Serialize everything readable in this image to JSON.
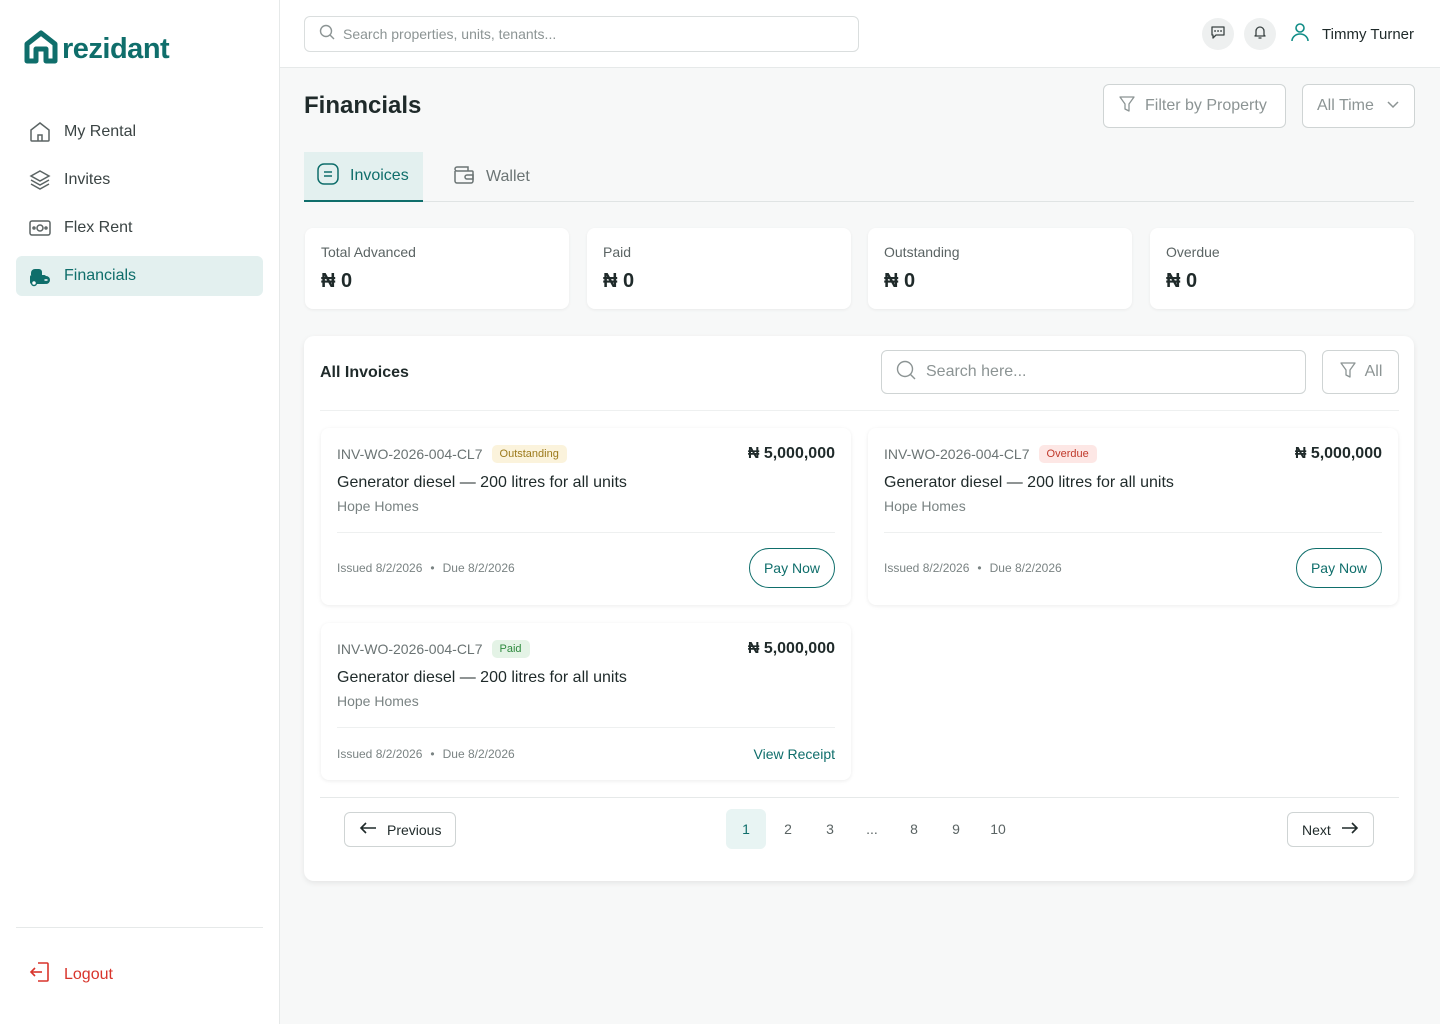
{
  "brand": {
    "name": "rezidant",
    "color": "#0f6e6b"
  },
  "sidebar": {
    "items": [
      {
        "label": "My Rental",
        "icon": "home-icon"
      },
      {
        "label": "Invites",
        "icon": "layers-icon"
      },
      {
        "label": "Flex Rent",
        "icon": "money-icon"
      },
      {
        "label": "Financials",
        "icon": "financials-icon",
        "active": true
      }
    ],
    "logout": "Logout"
  },
  "topbar": {
    "search_placeholder": "Search properties, units, tenants...",
    "user_name": "Timmy Turner"
  },
  "page": {
    "title": "Financials",
    "filter_property": "Filter by Property",
    "time_range": "All Time"
  },
  "tabs": [
    {
      "label": "Invoices",
      "active": true
    },
    {
      "label": "Wallet"
    }
  ],
  "stats": [
    {
      "label": "Total Advanced",
      "value": "₦ 0"
    },
    {
      "label": "Paid",
      "value": "₦ 0"
    },
    {
      "label": "Outstanding",
      "value": "₦ 0"
    },
    {
      "label": "Overdue",
      "value": "₦ 0"
    }
  ],
  "invoices_panel": {
    "title": "All Invoices",
    "search_placeholder": "Search here...",
    "filter_label": "All"
  },
  "invoices": [
    {
      "id": "INV-WO-2026-004-CL7",
      "status": "Outstanding",
      "amount": "₦ 5,000,000",
      "title": "Generator diesel — 200 litres for all units",
      "property": "Hope Homes",
      "issued": "Issued 8/2/2026",
      "due": "Due 8/2/2026",
      "action": "Pay Now"
    },
    {
      "id": "INV-WO-2026-004-CL7",
      "status": "Overdue",
      "amount": "₦ 5,000,000",
      "title": "Generator diesel — 200 litres for all units",
      "property": "Hope Homes",
      "issued": "Issued 8/2/2026",
      "due": "Due 8/2/2026",
      "action": "Pay Now"
    },
    {
      "id": "INV-WO-2026-004-CL7",
      "status": "Paid",
      "amount": "₦ 5,000,000",
      "title": "Generator diesel — 200 litres for all units",
      "property": "Hope Homes",
      "issued": "Issued 8/2/2026",
      "due": "Due 8/2/2026",
      "action": "View Receipt"
    }
  ],
  "pagination": {
    "previous": "Previous",
    "next": "Next",
    "pages": [
      "1",
      "2",
      "3",
      "...",
      "8",
      "9",
      "10"
    ],
    "current": "1"
  }
}
